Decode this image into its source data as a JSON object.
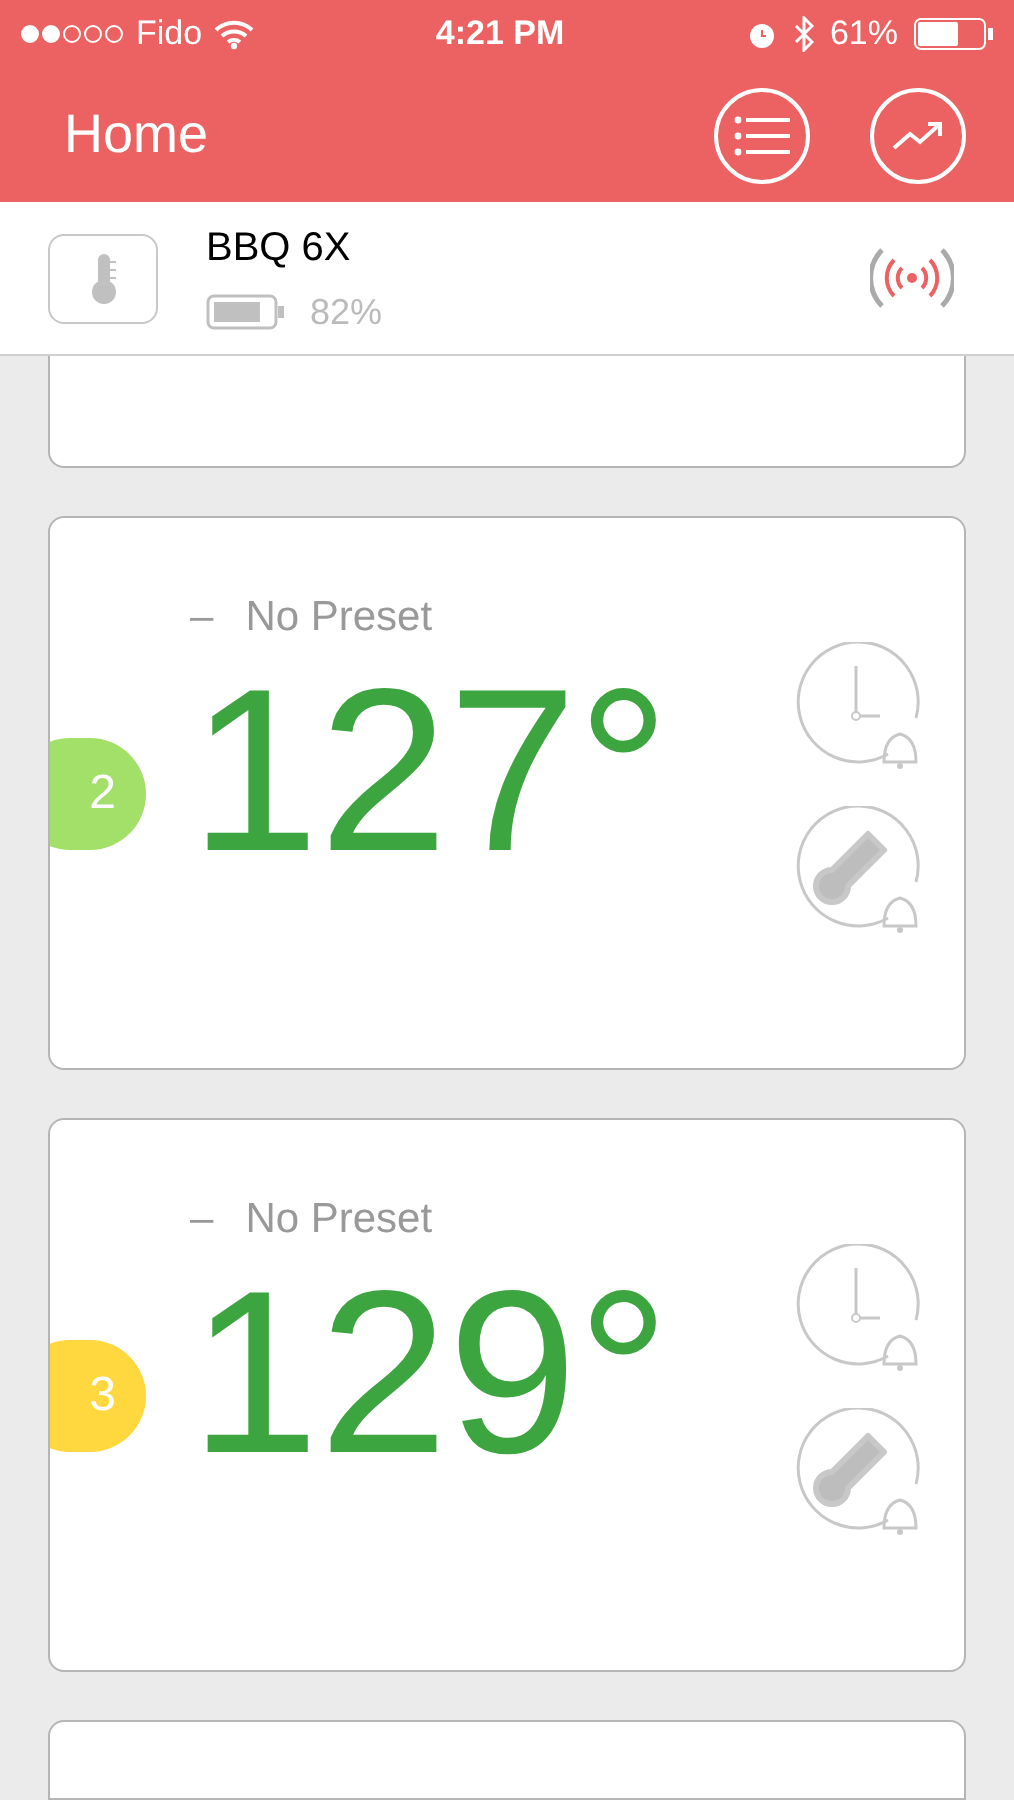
{
  "status_bar": {
    "carrier": "Fido",
    "time": "4:21 PM",
    "battery": "61%"
  },
  "header": {
    "title": "Home"
  },
  "device": {
    "name": "BBQ 6X",
    "battery": "82%"
  },
  "probes": [
    {
      "number": "2",
      "color": "#a3e06a",
      "dash": "–",
      "preset": "No Preset",
      "temperature": "127°"
    },
    {
      "number": "3",
      "color": "#ffd83f",
      "dash": "–",
      "preset": "No Preset",
      "temperature": "129°"
    }
  ]
}
